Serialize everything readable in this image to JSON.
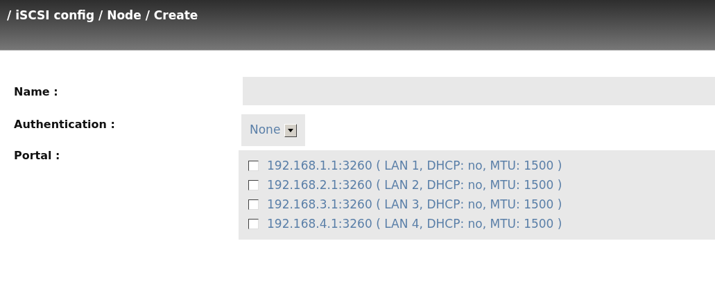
{
  "header": {
    "title": "/ iSCSI config / Node / Create"
  },
  "form": {
    "name": {
      "label": "Name :"
    },
    "authentication": {
      "label": "Authentication :",
      "value": "None"
    },
    "portal": {
      "label": "Portal :",
      "options": [
        {
          "label": "192.168.1.1:3260 ( LAN 1, DHCP: no, MTU: 1500 )",
          "checked": false
        },
        {
          "label": "192.168.2.1:3260 ( LAN 2, DHCP: no, MTU: 1500 )",
          "checked": false
        },
        {
          "label": "192.168.3.1:3260 ( LAN 3, DHCP: no, MTU: 1500 )",
          "checked": false
        },
        {
          "label": "192.168.4.1:3260 ( LAN 4, DHCP: no, MTU: 1500 )",
          "checked": false
        }
      ]
    }
  }
}
